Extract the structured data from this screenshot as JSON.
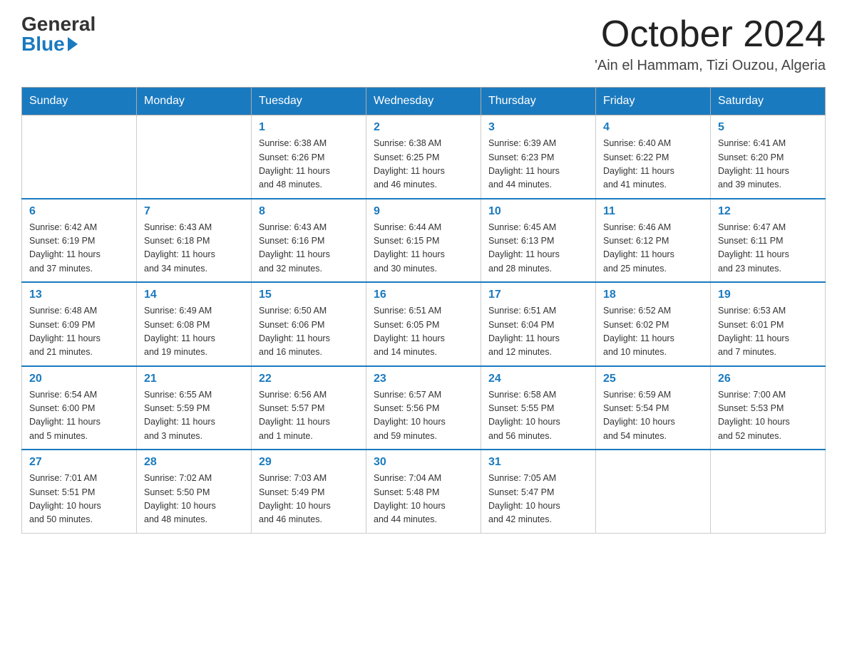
{
  "logo": {
    "general": "General",
    "blue": "Blue"
  },
  "title": "October 2024",
  "subtitle": "'Ain el Hammam, Tizi Ouzou, Algeria",
  "days_of_week": [
    "Sunday",
    "Monday",
    "Tuesday",
    "Wednesday",
    "Thursday",
    "Friday",
    "Saturday"
  ],
  "weeks": [
    [
      {
        "day": "",
        "info": ""
      },
      {
        "day": "",
        "info": ""
      },
      {
        "day": "1",
        "info": "Sunrise: 6:38 AM\nSunset: 6:26 PM\nDaylight: 11 hours\nand 48 minutes."
      },
      {
        "day": "2",
        "info": "Sunrise: 6:38 AM\nSunset: 6:25 PM\nDaylight: 11 hours\nand 46 minutes."
      },
      {
        "day": "3",
        "info": "Sunrise: 6:39 AM\nSunset: 6:23 PM\nDaylight: 11 hours\nand 44 minutes."
      },
      {
        "day": "4",
        "info": "Sunrise: 6:40 AM\nSunset: 6:22 PM\nDaylight: 11 hours\nand 41 minutes."
      },
      {
        "day": "5",
        "info": "Sunrise: 6:41 AM\nSunset: 6:20 PM\nDaylight: 11 hours\nand 39 minutes."
      }
    ],
    [
      {
        "day": "6",
        "info": "Sunrise: 6:42 AM\nSunset: 6:19 PM\nDaylight: 11 hours\nand 37 minutes."
      },
      {
        "day": "7",
        "info": "Sunrise: 6:43 AM\nSunset: 6:18 PM\nDaylight: 11 hours\nand 34 minutes."
      },
      {
        "day": "8",
        "info": "Sunrise: 6:43 AM\nSunset: 6:16 PM\nDaylight: 11 hours\nand 32 minutes."
      },
      {
        "day": "9",
        "info": "Sunrise: 6:44 AM\nSunset: 6:15 PM\nDaylight: 11 hours\nand 30 minutes."
      },
      {
        "day": "10",
        "info": "Sunrise: 6:45 AM\nSunset: 6:13 PM\nDaylight: 11 hours\nand 28 minutes."
      },
      {
        "day": "11",
        "info": "Sunrise: 6:46 AM\nSunset: 6:12 PM\nDaylight: 11 hours\nand 25 minutes."
      },
      {
        "day": "12",
        "info": "Sunrise: 6:47 AM\nSunset: 6:11 PM\nDaylight: 11 hours\nand 23 minutes."
      }
    ],
    [
      {
        "day": "13",
        "info": "Sunrise: 6:48 AM\nSunset: 6:09 PM\nDaylight: 11 hours\nand 21 minutes."
      },
      {
        "day": "14",
        "info": "Sunrise: 6:49 AM\nSunset: 6:08 PM\nDaylight: 11 hours\nand 19 minutes."
      },
      {
        "day": "15",
        "info": "Sunrise: 6:50 AM\nSunset: 6:06 PM\nDaylight: 11 hours\nand 16 minutes."
      },
      {
        "day": "16",
        "info": "Sunrise: 6:51 AM\nSunset: 6:05 PM\nDaylight: 11 hours\nand 14 minutes."
      },
      {
        "day": "17",
        "info": "Sunrise: 6:51 AM\nSunset: 6:04 PM\nDaylight: 11 hours\nand 12 minutes."
      },
      {
        "day": "18",
        "info": "Sunrise: 6:52 AM\nSunset: 6:02 PM\nDaylight: 11 hours\nand 10 minutes."
      },
      {
        "day": "19",
        "info": "Sunrise: 6:53 AM\nSunset: 6:01 PM\nDaylight: 11 hours\nand 7 minutes."
      }
    ],
    [
      {
        "day": "20",
        "info": "Sunrise: 6:54 AM\nSunset: 6:00 PM\nDaylight: 11 hours\nand 5 minutes."
      },
      {
        "day": "21",
        "info": "Sunrise: 6:55 AM\nSunset: 5:59 PM\nDaylight: 11 hours\nand 3 minutes."
      },
      {
        "day": "22",
        "info": "Sunrise: 6:56 AM\nSunset: 5:57 PM\nDaylight: 11 hours\nand 1 minute."
      },
      {
        "day": "23",
        "info": "Sunrise: 6:57 AM\nSunset: 5:56 PM\nDaylight: 10 hours\nand 59 minutes."
      },
      {
        "day": "24",
        "info": "Sunrise: 6:58 AM\nSunset: 5:55 PM\nDaylight: 10 hours\nand 56 minutes."
      },
      {
        "day": "25",
        "info": "Sunrise: 6:59 AM\nSunset: 5:54 PM\nDaylight: 10 hours\nand 54 minutes."
      },
      {
        "day": "26",
        "info": "Sunrise: 7:00 AM\nSunset: 5:53 PM\nDaylight: 10 hours\nand 52 minutes."
      }
    ],
    [
      {
        "day": "27",
        "info": "Sunrise: 7:01 AM\nSunset: 5:51 PM\nDaylight: 10 hours\nand 50 minutes."
      },
      {
        "day": "28",
        "info": "Sunrise: 7:02 AM\nSunset: 5:50 PM\nDaylight: 10 hours\nand 48 minutes."
      },
      {
        "day": "29",
        "info": "Sunrise: 7:03 AM\nSunset: 5:49 PM\nDaylight: 10 hours\nand 46 minutes."
      },
      {
        "day": "30",
        "info": "Sunrise: 7:04 AM\nSunset: 5:48 PM\nDaylight: 10 hours\nand 44 minutes."
      },
      {
        "day": "31",
        "info": "Sunrise: 7:05 AM\nSunset: 5:47 PM\nDaylight: 10 hours\nand 42 minutes."
      },
      {
        "day": "",
        "info": ""
      },
      {
        "day": "",
        "info": ""
      }
    ]
  ]
}
